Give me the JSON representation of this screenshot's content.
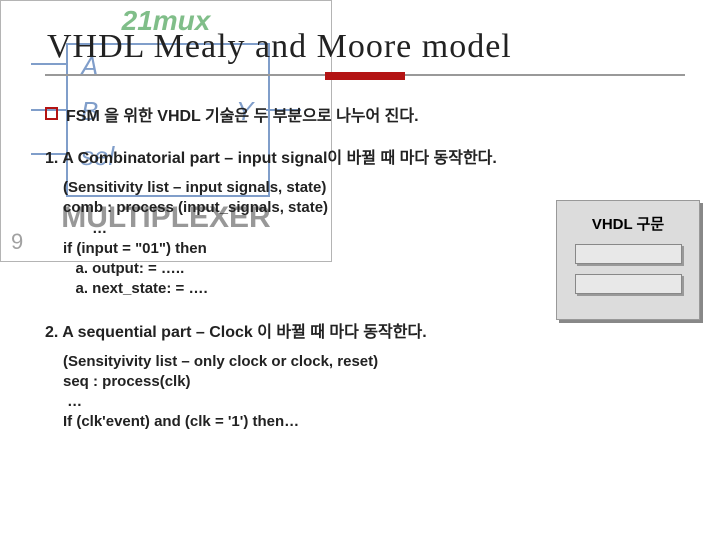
{
  "bg": {
    "mux": "21mux",
    "ports": {
      "a": "A",
      "b": "B",
      "sel": "sel",
      "y": "Y"
    },
    "multiplexer": "MULTIPLEXER",
    "nine": "9"
  },
  "title": "VHDL Mealy and Moore model",
  "intro": "FSM  을 위한 VHDL 기술은 두 부분으로 나누어 진다.",
  "part1": {
    "heading": "1. A Combinatorial part – input signal이 바뀔 때 마다 동작한다.",
    "code": "(Sensitivity list – input signals, state)\ncomb : process (input_signals, state)\n       …\nif (input = \"01\") then\n   a. output: = …..\n   a. next_state: = …."
  },
  "part2": {
    "heading": "2. A sequential part – Clock 이 바뀔 때 마다 동작한다.",
    "code": "(Sensityivity list – only clock or clock, reset)\nseq : process(clk)\n …\nIf (clk'event) and (clk = '1') then…"
  },
  "vhdl_box": "VHDL 구문"
}
